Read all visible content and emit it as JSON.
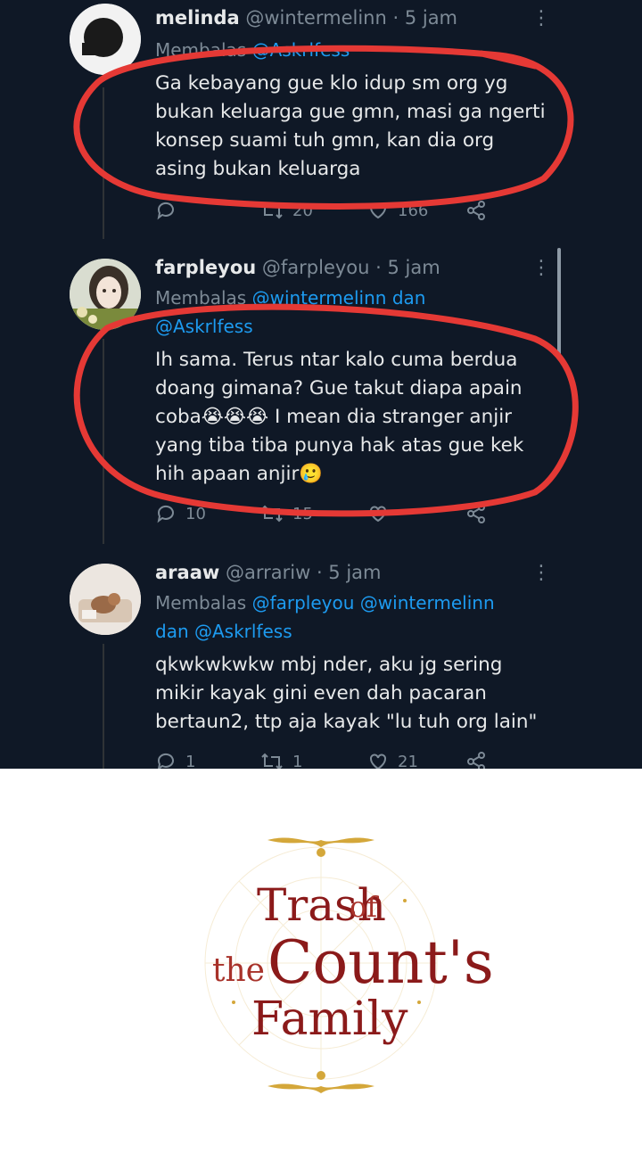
{
  "tweets": [
    {
      "name": "melinda",
      "handle": "@wintermelinn",
      "time": "· 5 jam",
      "reply_prefix": "Membalas",
      "reply_to": "@Askrlfess",
      "text_lines": [
        "Ga kebayang gue klo idup sm org yg",
        "bukan keluarga gue gmn, masi ga ngerti",
        "konsep suami tuh gmn, kan dia org",
        "asing bukan keluarga"
      ],
      "replies": "",
      "retweets": "20",
      "likes": "166"
    },
    {
      "name": "farpleyou",
      "handle": "@farpleyou",
      "time": "· 5 jam",
      "reply_prefix": "Membalas",
      "reply_to_1": "@wintermelinn",
      "reply_joiner": "dan",
      "reply_to_2": "@Askrlfess",
      "text_lines": [
        "Ih sama. Terus ntar kalo cuma berdua",
        "doang gimana? Gue takut diapa apain",
        "coba😭😭😭 I mean dia stranger anjir",
        "yang tiba tiba punya hak atas gue kek",
        "hih apaan anjir🥲"
      ],
      "replies": "10",
      "retweets": "15",
      "likes": ""
    },
    {
      "name": "araaw",
      "handle": "@arrariw",
      "time": "· 5 jam",
      "reply_prefix": "Membalas",
      "reply_to_1": "@farpleyou",
      "reply_to_2": "@wintermelinn",
      "reply_joiner": "dan",
      "reply_to_3": "@Askrlfess",
      "text_lines": [
        "qkwkwkwkw mbj nder, aku jg sering",
        "mikir kayak gini even dah pacaran",
        "bertaun2, ttp aja kayak \"lu tuh org lain\""
      ],
      "replies": "1",
      "retweets": "1",
      "likes": "21"
    }
  ],
  "more_icon": "⋮",
  "highlight_color": "#e53935",
  "logo": {
    "line1_a": "Trash",
    "line1_b": "of",
    "line2_a": "the",
    "line2_b": "Count's",
    "line3": "Family"
  },
  "colors": {
    "background": "#0f1826",
    "text": "#e7e9ea",
    "muted": "#7d8a96",
    "link": "#1d9bf0",
    "logo_red": "#8b1a1a",
    "logo_gold": "#d4a73a"
  }
}
